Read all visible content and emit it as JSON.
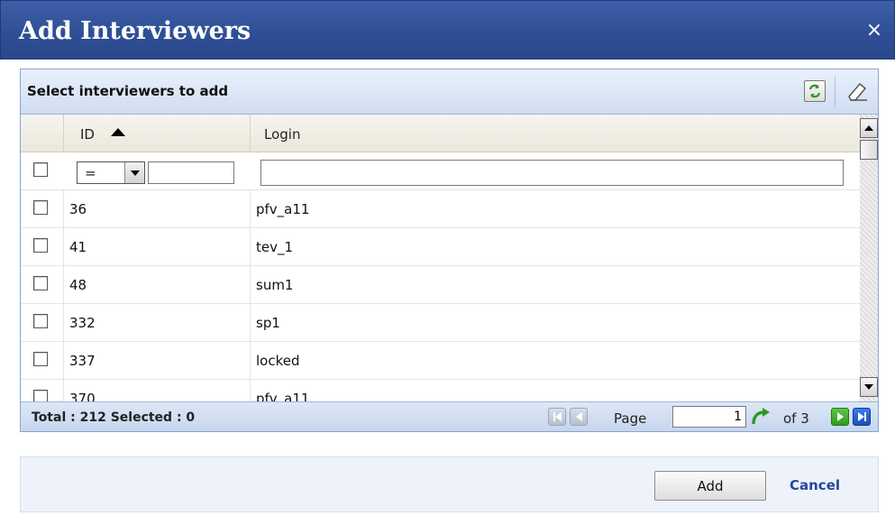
{
  "dialog": {
    "title": "Add Interviewers",
    "close_glyph": "×"
  },
  "grid": {
    "header_title": "Select interviewers to add",
    "columns": [
      {
        "label": "ID",
        "sort": "ascending"
      },
      {
        "label": "Login"
      }
    ],
    "filter": {
      "id_operator": "=",
      "id_value": "",
      "login_value": ""
    },
    "rows": [
      {
        "id": "36",
        "login": "pfv_a11"
      },
      {
        "id": "41",
        "login": "tev_1"
      },
      {
        "id": "48",
        "login": "sum1"
      },
      {
        "id": "332",
        "login": "sp1"
      },
      {
        "id": "337",
        "login": "locked"
      },
      {
        "id": "370",
        "login": "pfv_a11"
      }
    ],
    "footer": {
      "total_text": "Total : 212 Selected : 0",
      "page_label": "Page",
      "page_value": "1",
      "of_text": "of 3"
    }
  },
  "actions": {
    "add_label": "Add",
    "cancel_label": "Cancel"
  },
  "colors": {
    "title_bar": "#2f4f96",
    "accent_green": "#2e9a1f",
    "accent_blue": "#1b4fb8",
    "link": "#23489c"
  }
}
